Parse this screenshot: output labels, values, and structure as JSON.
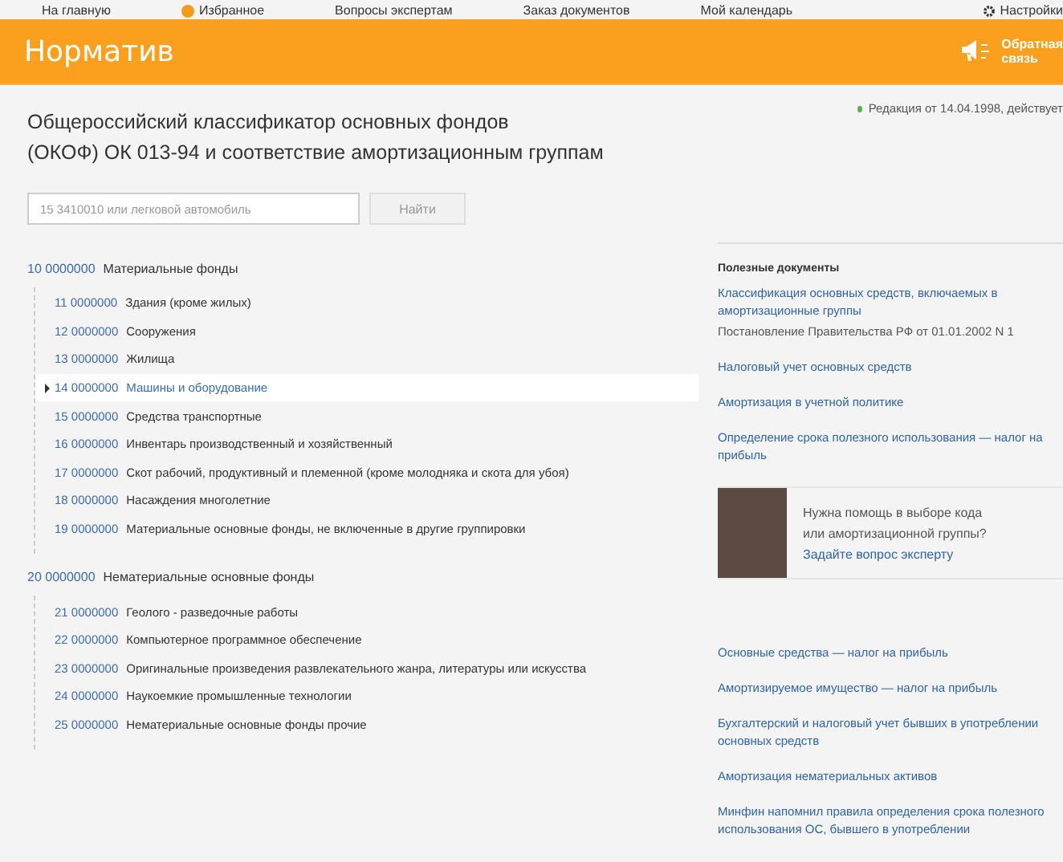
{
  "top_nav": {
    "items": [
      {
        "label": "На главную",
        "kind": "plain"
      },
      {
        "label": "Избранное",
        "kind": "alert"
      },
      {
        "label": "Вопросы экспертам",
        "kind": "plain"
      },
      {
        "label": "Заказ документов",
        "kind": "plain"
      },
      {
        "label": "Мой календарь",
        "kind": "plain"
      }
    ],
    "settings": "Настройки"
  },
  "header": {
    "title": "Норматив",
    "feedback_lines": [
      "Обратная",
      "связь"
    ]
  },
  "page": {
    "title_lines": [
      "Общероссийский классификатор основных фондов",
      "(ОКОФ) ОК 013-94 и соответствие амортизационным группам"
    ],
    "edition": {
      "text": "Редакция от 14.04.1998, действует",
      "color": "#4cb849"
    }
  },
  "search": {
    "placeholder": "15 3410010 или легковой автомобиль",
    "button": "Найти"
  },
  "tree": [
    {
      "code": "10 0000000",
      "name": "Материальные фонды",
      "children": [
        {
          "code": "11 0000000",
          "name": "Здания (кроме жилых)",
          "selected": false
        },
        {
          "code": "12 0000000",
          "name": "Сооружения",
          "selected": false
        },
        {
          "code": "13 0000000",
          "name": "Жилища",
          "selected": false
        },
        {
          "code": "14 0000000",
          "name": "Машины и оборудование",
          "selected": true
        },
        {
          "code": "15 0000000",
          "name": "Средства транспортные",
          "selected": false
        },
        {
          "code": "16 0000000",
          "name": "Инвентарь производственный и хозяйственный",
          "selected": false
        },
        {
          "code": "17 0000000",
          "name": "Скот рабочий, продуктивный и племенной (кроме молодняка и скота для убоя)",
          "selected": false
        },
        {
          "code": "18 0000000",
          "name": "Насаждения многолетние",
          "selected": false
        },
        {
          "code": "19 0000000",
          "name": "Материальные основные фонды, не включенные в другие группировки",
          "selected": false
        }
      ]
    },
    {
      "code": "20 0000000",
      "name": "Нематериальные основные фонды",
      "children": [
        {
          "code": "21 0000000",
          "name": "Геолого - разведочные работы",
          "selected": false
        },
        {
          "code": "22 0000000",
          "name": "Компьютерное программное обеспечение",
          "selected": false
        },
        {
          "code": "23 0000000",
          "name": "Оригинальные произведения развлекательного жанра, литературы или искусства",
          "selected": false
        },
        {
          "code": "24 0000000",
          "name": "Наукоемкие промышленные технологии",
          "selected": false
        },
        {
          "code": "25 0000000",
          "name": "Нематериальные основные фонды прочие",
          "selected": false
        }
      ]
    }
  ],
  "sidebar": {
    "useful_docs": {
      "heading": "Полезные документы",
      "items": [
        {
          "title": "Классификация основных средств, включаемых в амортизационные группы",
          "note": "Постановление Правительства РФ от 01.01.2002 N 1"
        },
        {
          "title": "Налоговый учет основных средств"
        },
        {
          "title": "Амортизация в учетной политике"
        },
        {
          "title": "Определение срока полезного использования — налог на прибыль"
        }
      ]
    },
    "expert": {
      "question_lines": [
        "Нужна помощь в выборе кода",
        "или амортизационной группы?"
      ],
      "link": "Задайте вопрос эксперту"
    },
    "links": [
      "Основные средства — налог на прибыль",
      "Амортизируемое имущество — налог на прибыль",
      "Бухгалтерский и налоговый учет бывших в употреблении основных средств",
      "Амортизация нематериальных активов",
      "Минфин напомнил правила определения срока полезного использования ОС, бывшего в употреблении"
    ]
  }
}
